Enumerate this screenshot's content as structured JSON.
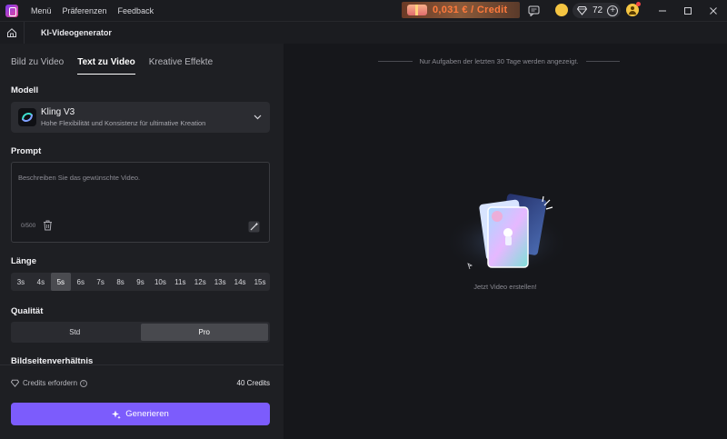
{
  "titlebar": {
    "menu": [
      "Menü",
      "Präferenzen",
      "Feedback"
    ],
    "credits_banner": "0,031 € / Credit",
    "gem_count": "72",
    "colors": {
      "accent": "#7c5cfc",
      "banner_text": "#ff7a3c",
      "coin": "#f5c542"
    }
  },
  "header": {
    "title": "KI-Videogenerator"
  },
  "tabs": [
    {
      "label": "Bild zu Video"
    },
    {
      "label": "Text zu Video"
    },
    {
      "label": "Kreative Effekte"
    }
  ],
  "active_tab": "Text zu Video",
  "model": {
    "section_label": "Modell",
    "name": "Kling V3",
    "description": "Hohe Flexibilität und Konsistenz für ultimative Kreation"
  },
  "prompt": {
    "section_label": "Prompt",
    "placeholder": "Beschreiben Sie das gewünschte Video.",
    "value": "",
    "count": "0/500"
  },
  "length": {
    "section_label": "Länge",
    "options": [
      "3s",
      "4s",
      "5s",
      "6s",
      "7s",
      "8s",
      "9s",
      "10s",
      "11s",
      "12s",
      "13s",
      "14s",
      "15s"
    ],
    "selected": "5s"
  },
  "quality": {
    "section_label": "Qualität",
    "options": [
      "Std",
      "Pro"
    ],
    "selected": "Pro"
  },
  "aspect_ratio": {
    "section_label": "Bildseitenverhältnis"
  },
  "footer": {
    "credits_label": "Credits erfordern",
    "credits_value": "40 Credits",
    "generate_label": "Generieren"
  },
  "main": {
    "notice": "Nur Aufgaben der letzten 30 Tage werden angezeigt.",
    "empty_text": "Jetzt Video erstellen!"
  }
}
